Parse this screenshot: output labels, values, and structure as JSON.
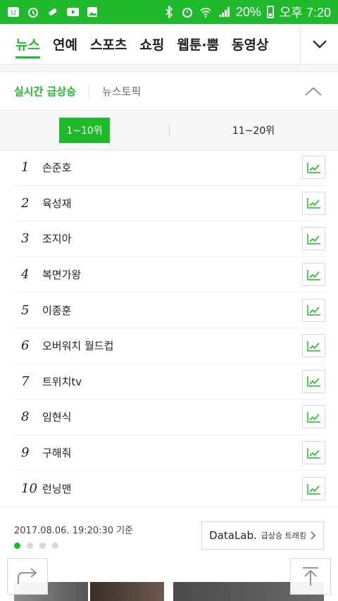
{
  "status_bar": {
    "battery": "20%",
    "time": "오후 7:20"
  },
  "nav": {
    "tabs": [
      "뉴스",
      "연예",
      "스포츠",
      "쇼핑",
      "웹툰·뿜",
      "동영상"
    ],
    "active_index": 0
  },
  "ranking": {
    "title": "실시간 급상승",
    "news_topic": "뉴스토픽",
    "range_tabs": [
      "1~10위",
      "11~20위"
    ],
    "items": [
      {
        "rank": "1",
        "keyword": "손준호"
      },
      {
        "rank": "2",
        "keyword": "육성재"
      },
      {
        "rank": "3",
        "keyword": "조지아"
      },
      {
        "rank": "4",
        "keyword": "복면가왕"
      },
      {
        "rank": "5",
        "keyword": "이종훈"
      },
      {
        "rank": "6",
        "keyword": "오버워치 월드컵"
      },
      {
        "rank": "7",
        "keyword": "트위치tv"
      },
      {
        "rank": "8",
        "keyword": "임현식"
      },
      {
        "rank": "9",
        "keyword": "구해줘"
      },
      {
        "rank": "10",
        "keyword": "런닝맨"
      }
    ],
    "timestamp": "2017.08.06. 19:20:30 기준",
    "datalab": {
      "brand": "DataLab.",
      "sub": "급상승 트래킹"
    },
    "page_dots": 4,
    "active_dot": 0
  },
  "colors": {
    "brand_green": "#1fba2b"
  }
}
